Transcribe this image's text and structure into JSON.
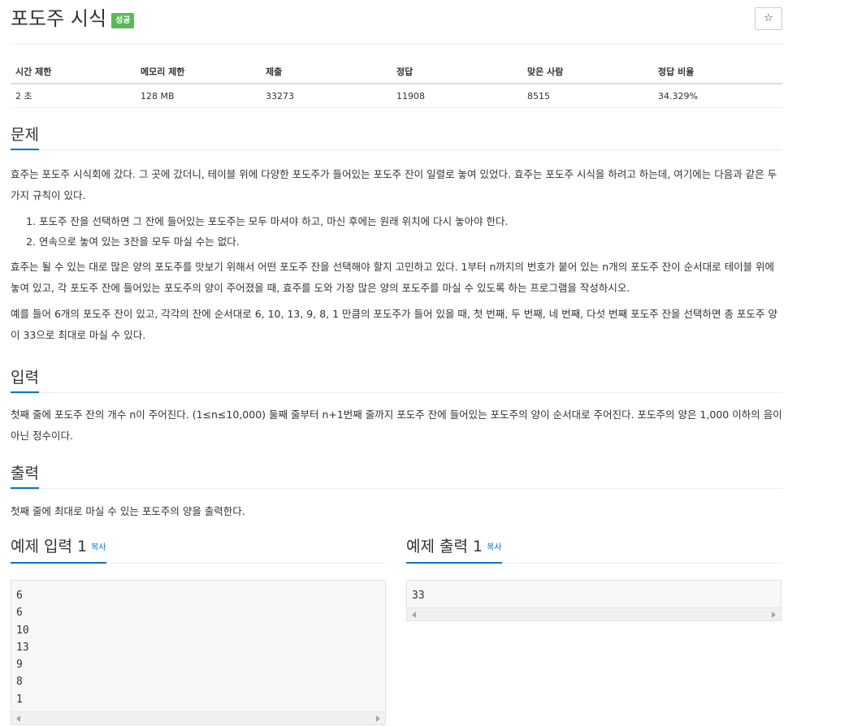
{
  "problem": {
    "title": "포도주 시식",
    "badge": "성공",
    "star_icon": "☆"
  },
  "info_table": {
    "headers": [
      "시간 제한",
      "메모리 제한",
      "제출",
      "정답",
      "맞은 사람",
      "정답 비율"
    ],
    "values": [
      "2 초",
      "128 MB",
      "33273",
      "11908",
      "8515",
      "34.329%"
    ]
  },
  "sections": {
    "problem_heading": "문제",
    "problem_p1": "효주는 포도주 시식회에 갔다. 그 곳에 갔더니, 테이블 위에 다양한 포도주가 들어있는 포도주 잔이 일렬로 놓여 있었다. 효주는 포도주 시식을 하려고 하는데, 여기에는 다음과 같은 두 가지 규칙이 있다.",
    "rules": [
      "포도주 잔을 선택하면 그 잔에 들어있는 포도주는 모두 마셔야 하고, 마신 후에는 원래 위치에 다시 놓아야 한다.",
      "연속으로 놓여 있는 3잔을 모두 마실 수는 없다."
    ],
    "problem_p2": "효주는 될 수 있는 대로 많은 양의 포도주를 맛보기 위해서 어떤 포도주 잔을 선택해야 할지 고민하고 있다. 1부터 n까지의 번호가 붙어 있는 n개의 포도주 잔이 순서대로 테이블 위에 놓여 있고, 각 포도주 잔에 들어있는 포도주의 양이 주어졌을 때, 효주를 도와 가장 많은 양의 포도주를 마실 수 있도록 하는 프로그램을 작성하시오.",
    "problem_p3": "예를 들어 6개의 포도주 잔이 있고, 각각의 잔에 순서대로 6, 10, 13, 9, 8, 1 만큼의 포도주가 들어 있을 때, 첫 번째, 두 번째, 네 번째, 다섯 번째 포도주 잔을 선택하면 총 포도주 양이 33으로 최대로 마실 수 있다.",
    "input_heading": "입력",
    "input_text": "첫째 줄에 포도주 잔의 개수 n이 주어진다. (1≤n≤10,000) 둘째 줄부터 n+1번째 줄까지 포도주 잔에 들어있는 포도주의 양이 순서대로 주어진다. 포도주의 양은 1,000 이하의 음이 아닌 정수이다.",
    "output_heading": "출력",
    "output_text": "첫째 줄에 최대로 마실 수 있는 포도주의 양을 출력한다."
  },
  "samples": {
    "input_heading": "예제 입력 1",
    "output_heading": "예제 출력 1",
    "copy_label": "복사",
    "input_text": "6\n6\n10\n13\n9\n8\n1",
    "output_text": "33"
  }
}
